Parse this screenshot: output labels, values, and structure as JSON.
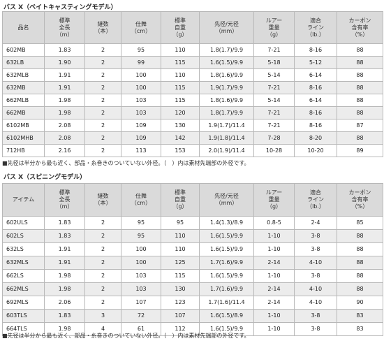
{
  "casting": {
    "title": "バス X（ベイトキャスティングモデル）",
    "headers": [
      [
        "品名"
      ],
      [
        "標準",
        "全長",
        "（m）"
      ],
      [
        "継数",
        "（本）"
      ],
      [
        "仕舞",
        "（cm）"
      ],
      [
        "標準",
        "自重",
        "（g）"
      ],
      [
        "先径/元径",
        "（mm）"
      ],
      [
        "ルアー",
        "重量",
        "（g）"
      ],
      [
        "適合",
        "ライン",
        "（lb.）"
      ],
      [
        "カーボン",
        "含有率",
        "（%）"
      ]
    ],
    "rows": [
      [
        "602MB",
        "1.83",
        "2",
        "95",
        "110",
        "1.8(1.7)/9.9",
        "7-21",
        "8-16",
        "88"
      ],
      [
        "632LB",
        "1.90",
        "2",
        "99",
        "115",
        "1.6(1.5)/9.9",
        "5-18",
        "5-12",
        "88"
      ],
      [
        "632MLB",
        "1.91",
        "2",
        "100",
        "110",
        "1.8(1.6)/9.9",
        "5-14",
        "6-14",
        "88"
      ],
      [
        "632MB",
        "1.91",
        "2",
        "100",
        "115",
        "1.9(1.7)/9.9",
        "7-21",
        "8-16",
        "88"
      ],
      [
        "662MLB",
        "1.98",
        "2",
        "103",
        "115",
        "1.8(1.6)/9.9",
        "5-14",
        "6-14",
        "88"
      ],
      [
        "662MB",
        "1.98",
        "2",
        "103",
        "120",
        "1.8(1.7)/9.9",
        "7-21",
        "8-16",
        "88"
      ],
      [
        "6102MB",
        "2.08",
        "2",
        "109",
        "130",
        "1.9(1.7)/11.4",
        "7-21",
        "8-16",
        "87"
      ],
      [
        "6102MHB",
        "2.08",
        "2",
        "109",
        "142",
        "1.9(1.8)/11.4",
        "7-28",
        "8-20",
        "88"
      ],
      [
        "712HB",
        "2.16",
        "2",
        "113",
        "153",
        "2.0(1.9)/11.4",
        "10-28",
        "10-20",
        "89"
      ]
    ],
    "note": "■先径は半分から最も近く、部品・糸巻きのついていない外径。（　）内は素材先端部の外径です。"
  },
  "spinning": {
    "title": "バス X（スピニングモデル）",
    "headers": [
      [
        "アイテム"
      ],
      [
        "標準",
        "全長",
        "（m）"
      ],
      [
        "継数",
        "（本）"
      ],
      [
        "仕舞",
        "（cm）"
      ],
      [
        "標準",
        "自重",
        "（g）"
      ],
      [
        "先径/元径",
        "（mm）"
      ],
      [
        "ルアー",
        "重量",
        "（g）"
      ],
      [
        "適合",
        "ライン",
        "（lb.）"
      ],
      [
        "カーボン",
        "含有率",
        "（%）"
      ]
    ],
    "rows": [
      [
        "602ULS",
        "1.83",
        "2",
        "95",
        "95",
        "1.4(1.3)/8.9",
        "0.8-5",
        "2-4",
        "85"
      ],
      [
        "602LS",
        "1.83",
        "2",
        "95",
        "110",
        "1.6(1.5)/9.9",
        "1-10",
        "3-8",
        "88"
      ],
      [
        "632LS",
        "1.91",
        "2",
        "100",
        "110",
        "1.6(1.5)/9.9",
        "1-10",
        "3-8",
        "88"
      ],
      [
        "632MLS",
        "1.91",
        "2",
        "100",
        "125",
        "1.7(1.6)/9.9",
        "2-14",
        "4-10",
        "88"
      ],
      [
        "662LS",
        "1.98",
        "2",
        "103",
        "115",
        "1.6(1.5)/9.9",
        "1-10",
        "3-8",
        "88"
      ],
      [
        "662MLS",
        "1.98",
        "2",
        "103",
        "130",
        "1.7(1.6)/9.9",
        "2-14",
        "4-10",
        "88"
      ],
      [
        "692MLS",
        "2.06",
        "2",
        "107",
        "123",
        "1.7(1.6)/11.4",
        "2-14",
        "4-10",
        "90"
      ],
      [
        "603TLS",
        "1.83",
        "3",
        "72",
        "107",
        "1.6(1.5)/8.9",
        "1-10",
        "3-8",
        "83"
      ],
      [
        "664TLS",
        "1.98",
        "4",
        "61",
        "112",
        "1.6(1.5)/9.9",
        "1-10",
        "3-8",
        "83"
      ]
    ],
    "note": "■先径は半分から最も近く、部品・糸巻きのついていない外径。（　）内は素材先端部の外径です。"
  }
}
